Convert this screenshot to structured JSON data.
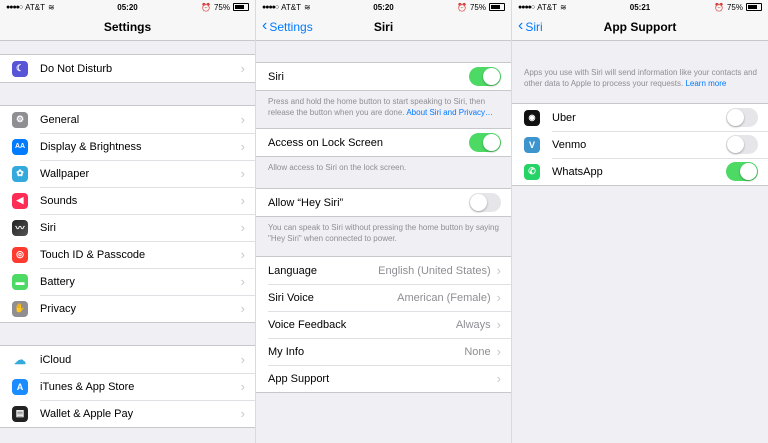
{
  "status": {
    "carrier": "AT&T",
    "battery": "75%",
    "times": [
      "05:20",
      "05:20",
      "05:21"
    ]
  },
  "settings": {
    "title": "Settings",
    "items": [
      {
        "label": "Do Not Disturb",
        "icon": "moon-icon",
        "color": "#5856d6"
      },
      {
        "label": "General",
        "icon": "gear-icon",
        "color": "#8e8e93"
      },
      {
        "label": "Display & Brightness",
        "icon": "text-size-icon",
        "color": "#007aff"
      },
      {
        "label": "Wallpaper",
        "icon": "flower-icon",
        "color": "#34aadc"
      },
      {
        "label": "Sounds",
        "icon": "speaker-icon",
        "color": "#ff2d55"
      },
      {
        "label": "Siri",
        "icon": "siri-icon",
        "color": "#222222"
      },
      {
        "label": "Touch ID & Passcode",
        "icon": "fingerprint-icon",
        "color": "#ff3b30"
      },
      {
        "label": "Battery",
        "icon": "battery-icon",
        "color": "#4cd964"
      },
      {
        "label": "Privacy",
        "icon": "hand-icon",
        "color": "#8e8e93"
      },
      {
        "label": "iCloud",
        "icon": "cloud-icon",
        "color": "#ffffff"
      },
      {
        "label": "iTunes & App Store",
        "icon": "app-store-icon",
        "color": "#1a8cff"
      },
      {
        "label": "Wallet & Apple Pay",
        "icon": "wallet-icon",
        "color": "#222222"
      }
    ]
  },
  "siri": {
    "back": "Settings",
    "title": "Siri",
    "siri_label": "Siri",
    "siri_desc": "Press and hold the home button to start speaking to Siri, then release the button when you are done.",
    "siri_link": "About Siri and Privacy…",
    "lock_label": "Access on Lock Screen",
    "lock_desc": "Allow access to Siri on the lock screen.",
    "hey_label": "Allow “Hey Siri”",
    "hey_desc": "You can speak to Siri without pressing the home button by saying \"Hey Siri\" when connected to power.",
    "options": [
      {
        "label": "Language",
        "value": "English (United States)"
      },
      {
        "label": "Siri Voice",
        "value": "American (Female)"
      },
      {
        "label": "Voice Feedback",
        "value": "Always"
      },
      {
        "label": "My Info",
        "value": "None"
      },
      {
        "label": "App Support",
        "value": ""
      }
    ]
  },
  "support": {
    "back": "Siri",
    "title": "App Support",
    "desc": "Apps you use with Siri will send information like your contacts and other data to Apple to process your requests.",
    "link": "Learn more",
    "apps": [
      {
        "label": "Uber",
        "on": false
      },
      {
        "label": "Venmo",
        "on": false
      },
      {
        "label": "WhatsApp",
        "on": true
      }
    ]
  }
}
